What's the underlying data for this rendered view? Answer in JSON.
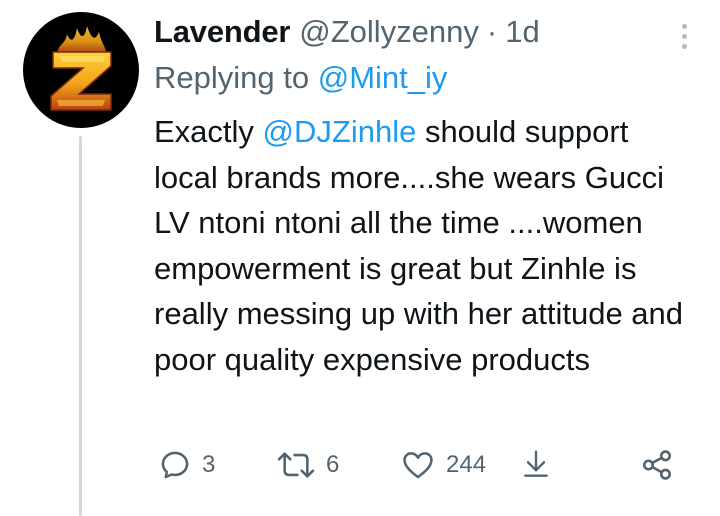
{
  "tweet": {
    "author_name": "Lavender",
    "author_handle": "@Zollyzenny",
    "separator": "·",
    "time": "1d",
    "replying_prefix": "Replying to ",
    "replying_to": "@Mint_iy",
    "text_parts": [
      "Exactly ",
      "@DJZinhle",
      " should support local brands more....she wears Gucci LV ntoni ntoni all the time ....women empowerment is great but Zinhle is really messing up with her attitude and poor quality expensive products"
    ],
    "avatar_letter": "Z",
    "avatar_colors": {
      "background": "#000000",
      "fire": "#f4a21b",
      "fire_dark": "#b8420f"
    }
  },
  "actions": {
    "reply": {
      "icon": "reply-icon",
      "count": "3"
    },
    "retweet": {
      "icon": "retweet-icon",
      "count": "6"
    },
    "like": {
      "icon": "heart-icon",
      "count": "244"
    },
    "save": {
      "icon": "download-icon"
    },
    "share": {
      "icon": "share-icon"
    }
  },
  "colors": {
    "link": "#1d9bf0",
    "secondary_text": "#536471",
    "thread_line": "#cfd9de"
  }
}
